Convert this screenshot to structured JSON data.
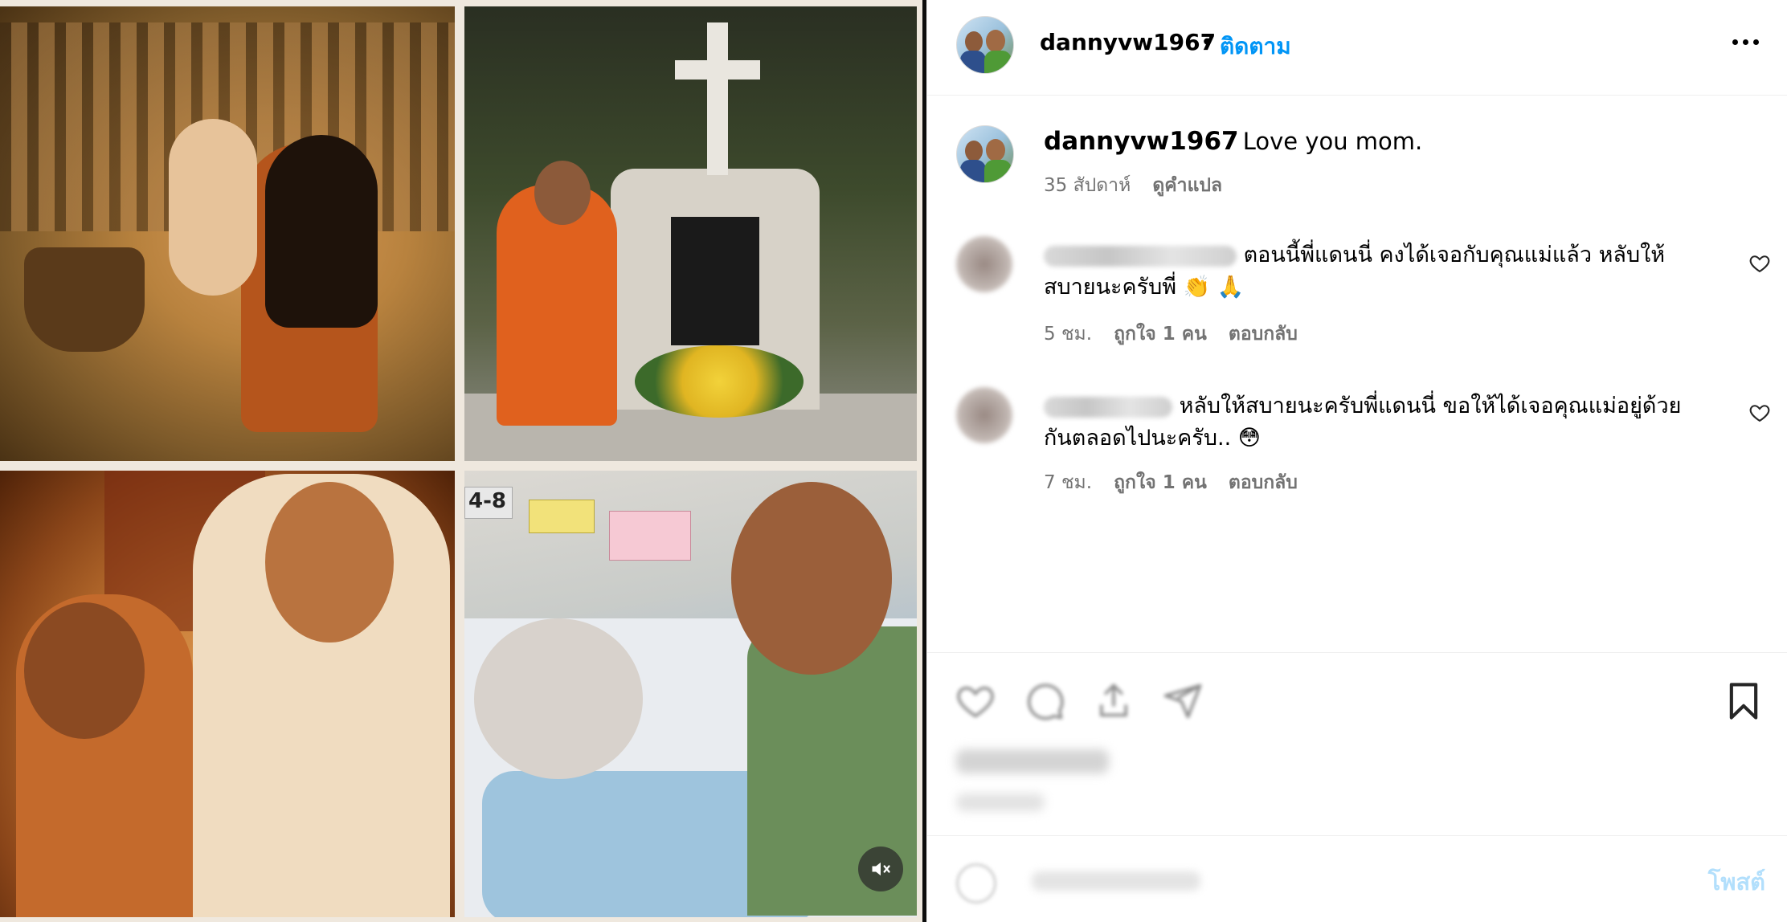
{
  "post": {
    "username": "dannyvw1967",
    "separator": "•",
    "follow_label": "ติดตาม",
    "more_icon": "more-horizontal-icon"
  },
  "caption": {
    "username": "dannyvw1967",
    "text": "Love you mom.",
    "time": "35 สัปดาห์",
    "translate_label": "ดูคำแปล"
  },
  "comments": [
    {
      "username": "",
      "text_line1": "ตอนนี้พี่แดนนี่ คงได้เจอกับคุณแม่แล้ว หลับให้",
      "text_line2": "สบายนะครับพี่ ",
      "emoji": "👏 🙏",
      "time": "5 ชม.",
      "likes": "ถูกใจ 1 คน",
      "reply_label": "ตอบกลับ"
    },
    {
      "username": "",
      "text_line1": "หลับให้สบายนะครับพี่แดนนี่ ขอให้ได้เจอคุณแม่อยู่ด้วย",
      "text_line2": "กันตลอดไปนะครับ.. ",
      "emoji": "😳",
      "time": "7 ชม.",
      "likes": "ถูกใจ 1 คน",
      "reply_label": "ตอบกลับ"
    }
  ],
  "actions": {
    "icons": [
      "heart-icon",
      "comment-icon",
      "share-icon",
      "send-icon",
      "bookmark-icon"
    ]
  },
  "comment_box": {
    "post_label": "โพสต์"
  },
  "media": {
    "photo_labels": [
      "4-8"
    ],
    "mute_icon": "speaker-muted-icon"
  }
}
